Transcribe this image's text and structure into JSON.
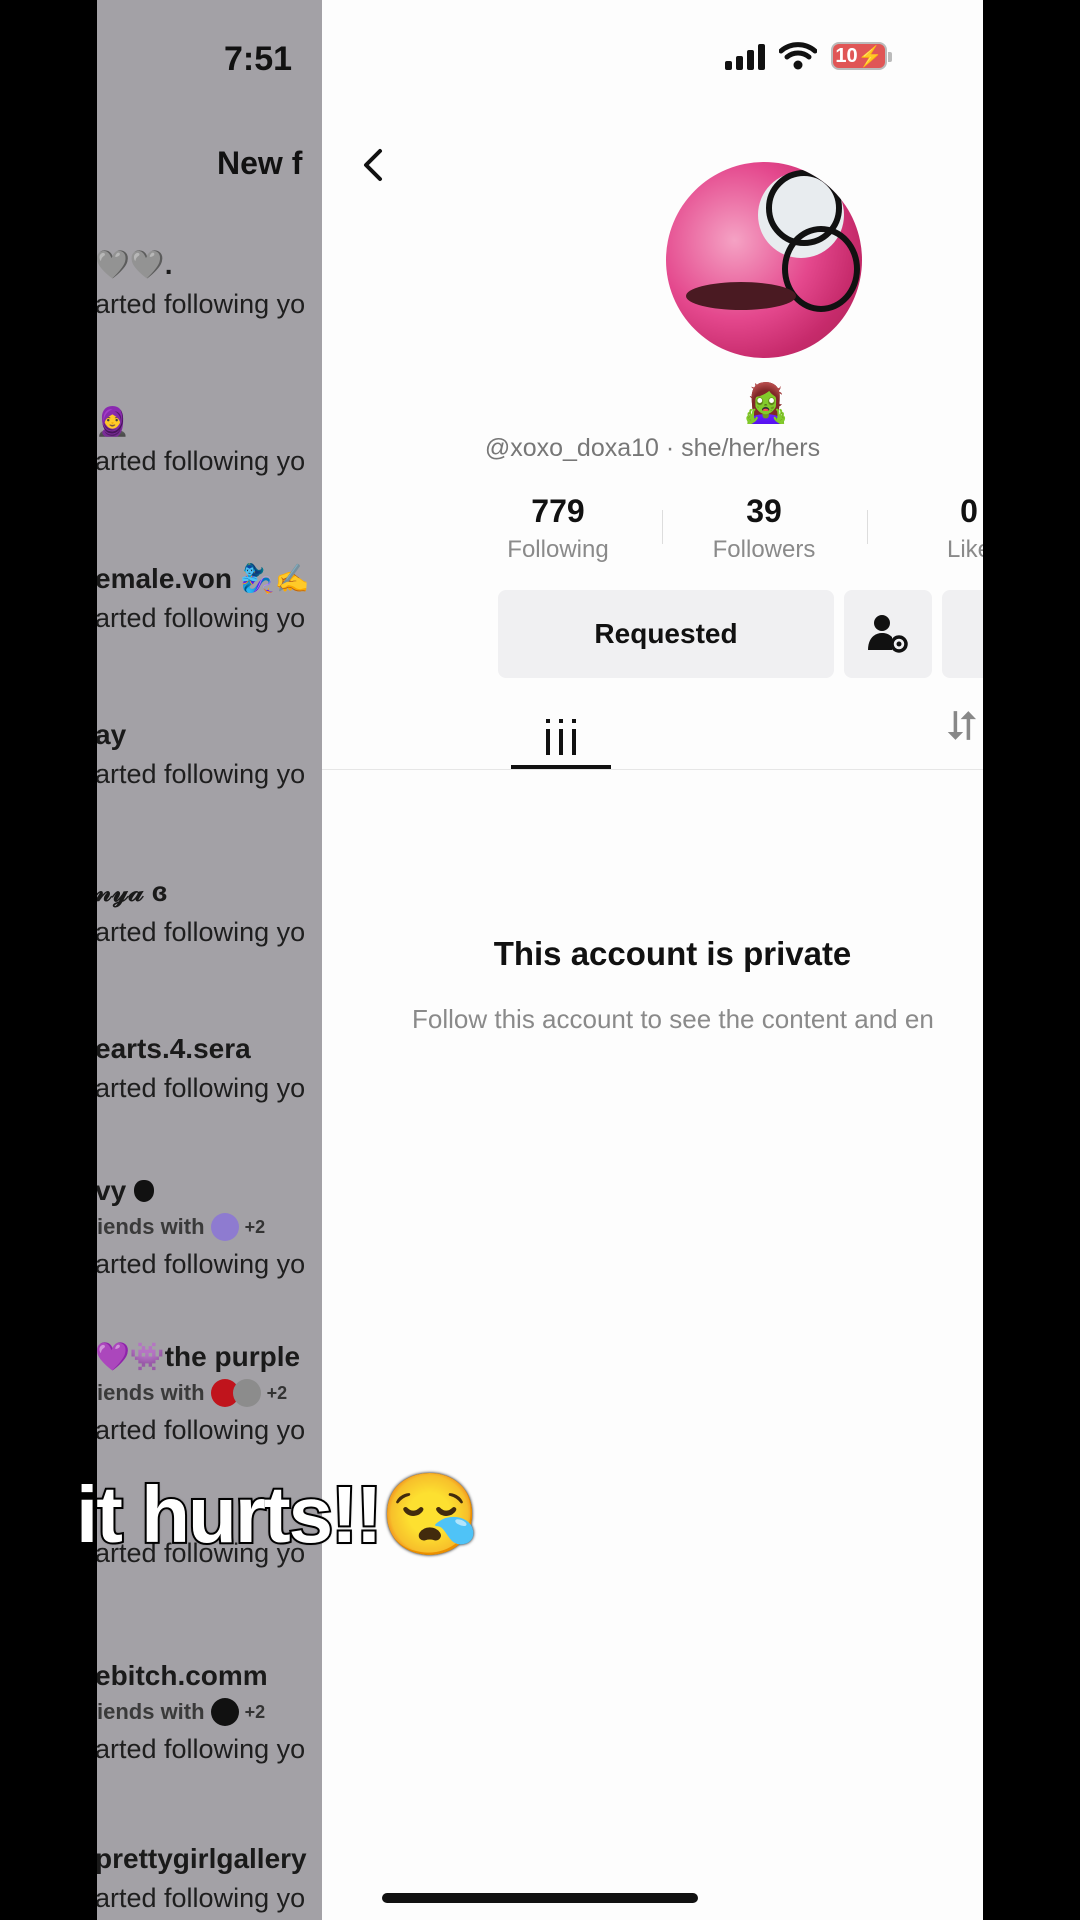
{
  "status_bar": {
    "time": "7:51",
    "battery": "10"
  },
  "notifications": {
    "title": "New f",
    "items": [
      {
        "name": "🩶🩶.",
        "sub": "arted following yo",
        "friends": ""
      },
      {
        "name": "🧕",
        "sub": "arted following yo",
        "friends": ""
      },
      {
        "name": "emale.von 🧞‍♀️✍",
        "sub": "arted following yo",
        "friends": ""
      },
      {
        "name": "ay",
        "sub": "arted following yo",
        "friends": ""
      },
      {
        "name": "𝓃𝓎𝒶 ɞ",
        "sub": "arted following yo",
        "friends": ""
      },
      {
        "name": "earts.4.sera",
        "sub": "arted following yo",
        "friends": ""
      },
      {
        "name": "vy ",
        "sub": "arted following yo",
        "friends": "iends with",
        "plus": "+2"
      },
      {
        "name": "💜👾the purple",
        "sub": "arted following yo",
        "friends": "iends with",
        "plus": "+2"
      },
      {
        "name": "",
        "sub": "arted following yo",
        "friends": ""
      },
      {
        "name": "ebitch.comm",
        "sub": "arted following yo",
        "friends": "iends with",
        "plus": "+2"
      },
      {
        "name": "prettygirlgallery",
        "sub": "arted following yo",
        "friends": ""
      }
    ]
  },
  "profile": {
    "emoji": "🧟‍♀️",
    "handle": "@xoxo_doxa10 · she/her/hers",
    "stats": [
      {
        "value": "779",
        "label": "Following"
      },
      {
        "value": "39",
        "label": "Followers"
      },
      {
        "value": "0",
        "label": "Like"
      }
    ],
    "requested_label": "Requested",
    "private_title": "This account is private",
    "private_subtitle": "Follow this account to see the content and en"
  },
  "caption": "it hurts!!😪"
}
